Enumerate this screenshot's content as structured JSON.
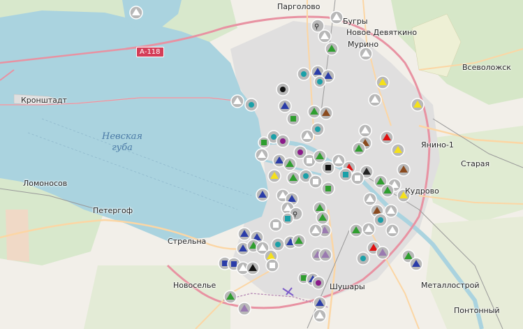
{
  "map": {
    "sea_label_line1": "Невская",
    "sea_label_line2": "губа",
    "road_label": "А-118",
    "places": [
      {
        "id": "pargolovo",
        "name": "Парголово"
      },
      {
        "id": "bugry",
        "name": "Бугры"
      },
      {
        "id": "novoe-devyatkino",
        "name": "Новое Девяткино"
      },
      {
        "id": "murino",
        "name": "Мурино"
      },
      {
        "id": "vsevolozhsk",
        "name": "Всеволожск"
      },
      {
        "id": "kronshtadt",
        "name": "Кронштадт"
      },
      {
        "id": "yanino",
        "name": "Янино-1"
      },
      {
        "id": "staraya",
        "name": "Старая"
      },
      {
        "id": "lomonosov",
        "name": "Ломоносов"
      },
      {
        "id": "peterhof",
        "name": "Петергоф"
      },
      {
        "id": "kudrovo",
        "name": "Кудрово"
      },
      {
        "id": "strelna",
        "name": "Стрельна"
      },
      {
        "id": "novoselye",
        "name": "Новоселье"
      },
      {
        "id": "shushary",
        "name": "Шушары"
      },
      {
        "id": "metallostroy",
        "name": "Металлострой"
      },
      {
        "id": "pontonny",
        "name": "Понтонный"
      }
    ],
    "colors": {
      "land": "#f2efe9",
      "water": "#aad3df",
      "forest": "#c8e3c0",
      "farm": "#eef0d5",
      "urban": "#e0dfdf",
      "motorway": "#e892a2",
      "primary": "#fcd6a4",
      "rail": "#999999",
      "marker_bg": "#b8b8b8",
      "marker_ring": "#ffffff"
    },
    "marker_types": [
      "triangle",
      "square",
      "circle",
      "hiker-icon"
    ]
  }
}
